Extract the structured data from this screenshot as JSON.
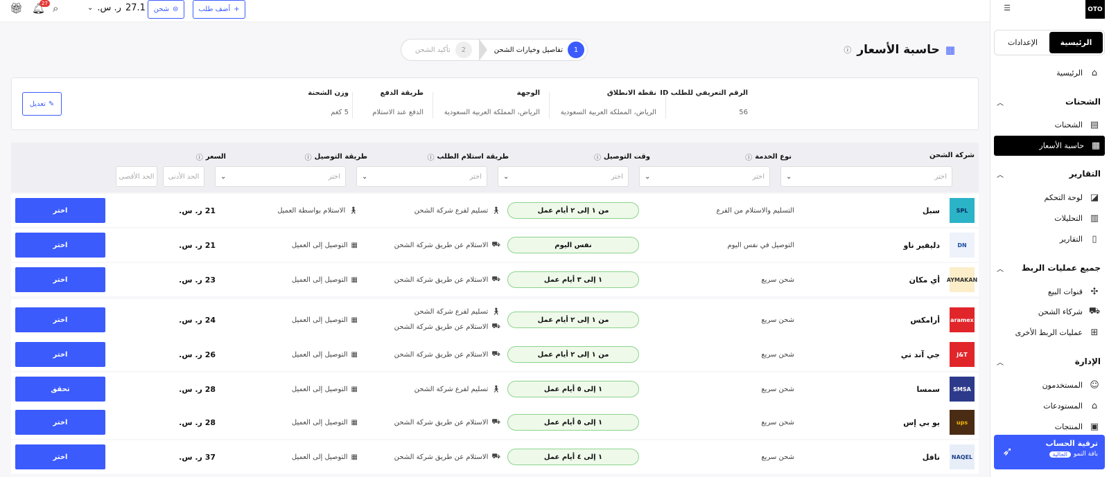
{
  "topbar": {
    "notif_count": "27",
    "balance_amount": "27.1",
    "balance_currency": "ر. س.",
    "ship_btn": "شحن",
    "add_order_btn": "أضف طلب"
  },
  "sidebar": {
    "logo": "OTO",
    "toggle_home": "الرئيسية",
    "toggle_settings": "الإعدادات",
    "home_item": "الرئيسية",
    "sections": [
      {
        "title": "الشحنات",
        "items": [
          "الشحنات",
          "حاسبة الأسعار"
        ]
      },
      {
        "title": "التقارير",
        "items": [
          "لوحة التحكم",
          "التحليلات",
          "التقارير"
        ]
      },
      {
        "title": "جميع عمليات الربط",
        "items": [
          "قنوات البيع",
          "شركاء الشحن",
          "عمليات الربط الأخرى"
        ]
      },
      {
        "title": "الإدارة",
        "items": [
          "المستخدمون",
          "المستودعات",
          "المنتجات"
        ]
      }
    ],
    "upgrade_title": "ترقية الحساب",
    "upgrade_plan": "باقة النمو",
    "upgrade_pill": "الحالية"
  },
  "page": {
    "title": "حاسبة الأسعار",
    "steps": [
      {
        "num": "1",
        "label": "تفاصيل وخيارات الشحن"
      },
      {
        "num": "2",
        "label": "تأكيد الشحن"
      }
    ]
  },
  "summary": {
    "order_id_label": "الرقم التعريفي للطلب ID",
    "order_id": "56",
    "origin_label": "نقطة الانطلاق",
    "origin": "الرياض، المملكة العربية السعودية",
    "destination_label": "الوجهة",
    "destination": "الرياض، المملكة العربية السعودية",
    "payment_label": "طريقة الدفع",
    "payment": "الدفع عند الاستلام",
    "weight_label": "وزن الشحنة",
    "weight": "5 كغم",
    "edit_btn": "تعديل"
  },
  "filters": {
    "carrier": "شركة الشحن",
    "service": "نوع الخدمة",
    "time": "وقت التوصيل",
    "pickup": "طريقة استلام الطلب",
    "delivery": "طريقة التوصيل",
    "price": "السعر",
    "placeholder": "اختر",
    "min": "الحد الأدنى",
    "max": "الحد الأقصى"
  },
  "rows": [
    {
      "carrier": "سبل",
      "logo": "SPL",
      "logo_bg": "#2bb3c7",
      "logo_fg": "#0a2a5e",
      "service": "التسليم والاستلام من الفرع",
      "time": "من ١ إلى ٢ أيام عمل",
      "pickup": [
        "تسليم لفرع شركة الشحن"
      ],
      "delivery": "الاستلام بواسطة العميل",
      "price": "21 ر. س.",
      "btn": "اختر"
    },
    {
      "carrier": "دليفير ناو",
      "logo": "DN",
      "logo_bg": "#eef2fb",
      "logo_fg": "#1c4fa0",
      "service": "التوصيل في نفس اليوم",
      "time": "نفس اليوم",
      "pickup": [
        "الاستلام عن طريق شركة الشحن"
      ],
      "delivery": "التوصيل إلى العميل",
      "price": "21 ر. س.",
      "btn": "اختر"
    },
    {
      "carrier": "أي مكان",
      "logo": "AYMAKAN",
      "logo_bg": "#fbeec9",
      "logo_fg": "#333",
      "service": "شحن سريع",
      "time": "١ إلى ٣ أيام عمل",
      "pickup": [
        "الاستلام عن طريق شركة الشحن"
      ],
      "delivery": "التوصيل إلى العميل",
      "price": "23 ر. س.",
      "btn": "اختر"
    },
    {
      "carrier": "أرامكس",
      "logo": "aramex",
      "logo_bg": "#e1262b",
      "logo_fg": "#fff",
      "service": "شحن سريع",
      "time": "من ١ إلى ٢ أيام عمل",
      "pickup": [
        "تسليم لفرع شركة الشحن",
        "الاستلام عن طريق شركة الشحن"
      ],
      "delivery": "التوصيل إلى العميل",
      "price": "24 ر. س.",
      "btn": "اختر"
    },
    {
      "carrier": "جي آند تي",
      "logo": "J&T",
      "logo_bg": "#e1262b",
      "logo_fg": "#fff",
      "service": "شحن سريع",
      "time": "من ١ إلى ٢ أيام عمل",
      "pickup": [
        "الاستلام عن طريق شركة الشحن"
      ],
      "delivery": "التوصيل إلى العميل",
      "price": "26 ر. س.",
      "btn": "اختر"
    },
    {
      "carrier": "سمسا",
      "logo": "SMSA",
      "logo_bg": "#2d3a8c",
      "logo_fg": "#fff",
      "service": "شحن سريع",
      "time": "١ إلى ٥ أيام عمل",
      "pickup": [
        "تسليم لفرع شركة الشحن"
      ],
      "delivery": "التوصيل إلى العميل",
      "price": "28 ر. س.",
      "btn": "تحقق"
    },
    {
      "carrier": "يو بي إس",
      "logo": "ups",
      "logo_bg": "#4a2c14",
      "logo_fg": "#f5b800",
      "service": "شحن سريع",
      "time": "١ إلى ٥ أيام عمل",
      "pickup": [
        "الاستلام عن طريق شركة الشحن"
      ],
      "delivery": "التوصيل إلى العميل",
      "price": "28 ر. س.",
      "btn": "اختر"
    },
    {
      "carrier": "نافل",
      "logo": "NAQEL",
      "logo_bg": "#e8eef8",
      "logo_fg": "#1c3f8a",
      "service": "شحن سريع",
      "time": "١ إلى ٤ أيام عمل",
      "pickup": [
        "الاستلام عن طريق شركة الشحن"
      ],
      "delivery": "التوصيل إلى العميل",
      "price": "37 ر. س.",
      "btn": "اختر"
    }
  ],
  "colors": {
    "accent": "#3b5bfd",
    "pill_bg": "#eef9ea",
    "pill_border": "#8bd48b"
  }
}
